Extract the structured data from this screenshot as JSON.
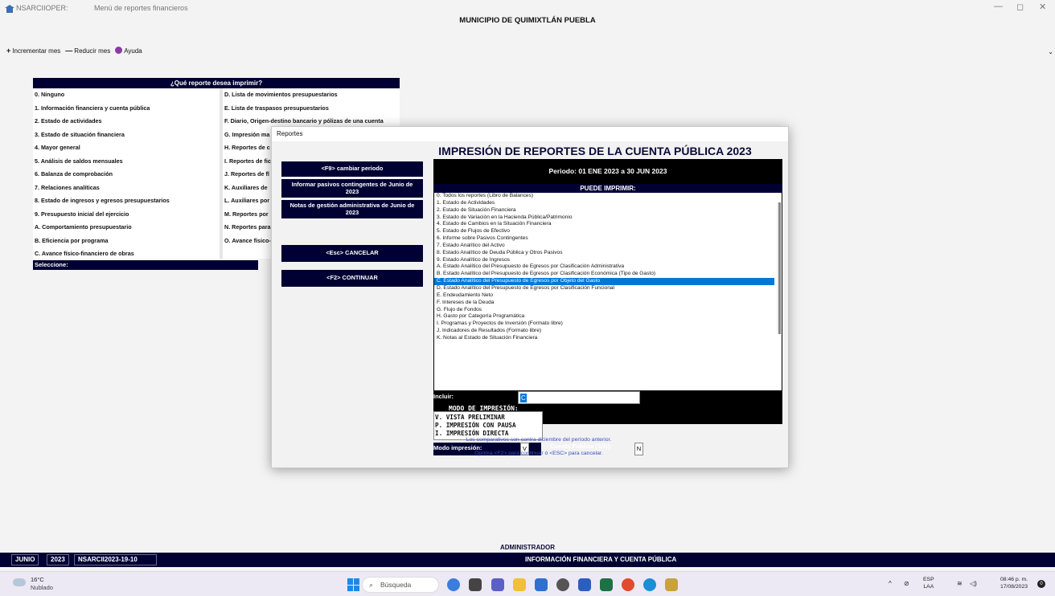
{
  "window": {
    "app_name": "NSARCIIOPER:",
    "title": "Menú de reportes financieros",
    "municipio": "MUNICIPIO DE QUIMIXTLÁN PUEBLA",
    "minimize": "—",
    "maximize": "◻",
    "close": "✕"
  },
  "toolbar": {
    "increment_glyph": "+",
    "increment_label": "Incrementar mes",
    "decrement_glyph": "—",
    "decrement_label": "Reducir mes",
    "help_label": "Ayuda"
  },
  "menu": {
    "header": "¿Qué reporte desea imprimir?",
    "left_items": [
      "0. Ninguno",
      "1. Información financiera y cuenta pública",
      "2. Estado de actividades",
      "3. Estado de situación financiera",
      "4. Mayor general",
      "5. Análisis de saldos mensuales",
      "6. Balanza de comprobación",
      "7. Relaciones analíticas",
      "8. Estado de ingresos y egresos presupuestarios",
      "9. Presupuesto inicial del ejercicio",
      "A. Comportamiento presupuestario",
      "B. Eficiencia por programa",
      "C. Avance físico-financiero de obras"
    ],
    "right_items": [
      "D. Lista de movimientos presupuestarios",
      "E. Lista de traspasos presupuestarios",
      "F. Diario, Origen-destino bancario y pólizas de una cuenta",
      "G. Impresión ma",
      "H. Reportes de c",
      "I. Reportes de fic",
      "J. Reportes de fl",
      "K. Auxiliares de",
      "L. Auxiliares por",
      "M. Reportes por",
      "N. Reportes para",
      "O. Avance físico-"
    ],
    "footer": "Seleccione:"
  },
  "dialog": {
    "title": "Reportes",
    "heading": "IMPRESIÓN DE REPORTES DE LA CUENTA PÚBLICA 2023",
    "btn_periodo": "<F9> cambiar periodo",
    "btn_pasivos": "Informar pasivos contingentes de Junio de 2023",
    "btn_notas": "Notas de gestión administrativa de Junio de 2023",
    "btn_cancelar": "<Esc> CANCELAR",
    "btn_continuar": "<F2> CONTINUAR",
    "periodo": "Periodo: 01 ENE 2023 a 30 JUN 2023",
    "puede_imprimir": "PUEDE IMPRIMIR:",
    "reports": [
      "0. Todos los reportes (Libro de Balances)",
      "1. Estado de Actividades",
      "2. Estado de Situación Financiera",
      "3. Estado de Variación en la Hacienda Pública/Patrimonio",
      "4. Estado de Cambios en la Situación Financiera",
      "5. Estado de Flujos de Efectivo",
      "6. Informe sobre Pasivos Contingentes",
      "7. Estado Analítico del Activo",
      "8. Estado Analítico de Deuda Pública y Otros Pasivos",
      "9. Estado Analítico de Ingresos",
      "A. Estado Analítico del Presupuesto de Egresos por Clasificación Administrativa",
      "B. Estado Analítico del Presupuesto de Egresos por Clasificación Económica (Tipo de Gasto)",
      "C. Estado Analítico del Presupuesto de Egresos por Objeto del Gasto",
      "D. Estado Analítico del Presupuesto de Egresos por Clasificación Funcional",
      "E. Endeudamiento Neto",
      "F. Intereses de la Deuda",
      "G. Flujo de Fondos",
      "H. Gasto por Categoría Programática",
      "I. Programas y Proyectos de Inversión (Formato libre)",
      "J. Indicadores de Resultados (Formato libre)",
      "K. Notas al Estado de Situación Financiera"
    ],
    "selected_index": 12,
    "incluir_label": "Incluir:",
    "incluir_value": "C",
    "modo_title": "MODO DE IMPRESIÓN:",
    "modo_options": [
      "V. VISTA PRELIMINAR",
      "P. IMPRESIÓN CON PAUSA",
      "I. IMPRESIÓN DIRECTA"
    ],
    "modo_label": "Modo impresión:",
    "modo_value": "V",
    "cuenta_label": "Cuenta Pública [S/N]:",
    "cuenta_value": "N",
    "note1": "Los comparativos son contra diciembre del período anterior.",
    "note2": "Oprima <F2> para continuar ó <ESC> para cancelar."
  },
  "status": {
    "user": "ADMINISTRADOR",
    "month": "JUNIO",
    "year": "2023",
    "db": "NSARCII2023-19-10",
    "section": "INFORMACIÓN FINANCIERA Y CUENTA PÚBLICA"
  },
  "taskbar": {
    "temp": "16°C",
    "weather": "Nublado",
    "search": "Búsqueda",
    "lang1": "ESP",
    "lang2": "LAA",
    "time": "08:46 p. m.",
    "date": "17/08/2023",
    "notif_count": "0",
    "accent": "#1e88e5"
  }
}
